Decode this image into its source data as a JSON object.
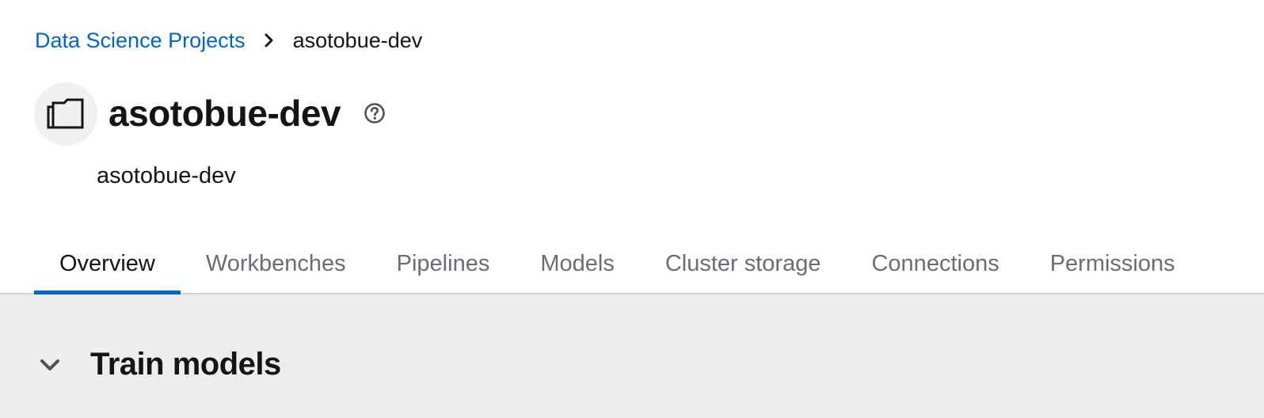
{
  "breadcrumb": {
    "parent_label": "Data Science Projects",
    "current_label": "asotobue-dev"
  },
  "header": {
    "title": "asotobue-dev",
    "subtitle": "asotobue-dev",
    "icon": "folder-icon",
    "help_icon": "question-circle-icon"
  },
  "tabs": [
    {
      "label": "Overview",
      "active": true
    },
    {
      "label": "Workbenches",
      "active": false
    },
    {
      "label": "Pipelines",
      "active": false
    },
    {
      "label": "Models",
      "active": false
    },
    {
      "label": "Cluster storage",
      "active": false
    },
    {
      "label": "Connections",
      "active": false
    },
    {
      "label": "Permissions",
      "active": false
    }
  ],
  "section": {
    "title": "Train models",
    "expanded": true,
    "toggle_icon": "chevron-down-icon"
  },
  "colors": {
    "link": "#0066cc",
    "active_tab_indicator": "#0066cc",
    "content_background": "#ededed"
  }
}
